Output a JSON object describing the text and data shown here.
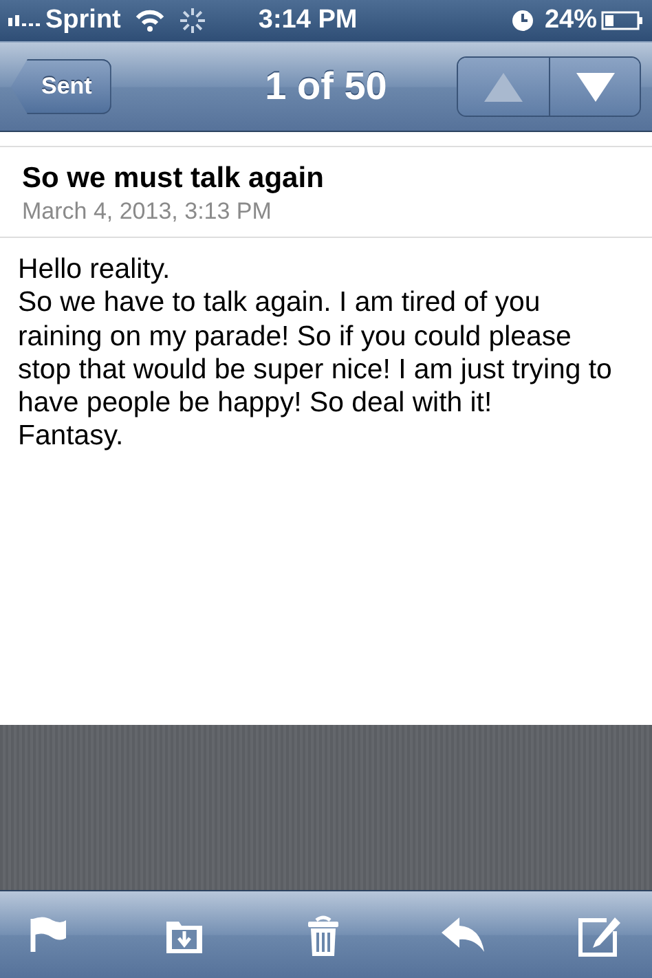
{
  "status_bar": {
    "carrier": "Sprint",
    "time": "3:14 PM",
    "battery": "24%"
  },
  "nav_bar": {
    "back": "Sent",
    "title": "1 of 50",
    "previous": {
      "disabled": true
    },
    "next": {
      "disabled": false
    }
  },
  "message": {
    "subject": "So we must talk again",
    "date": "March 4, 2013, 3:13 PM",
    "body": [
      "Hello reality.",
      "So we have to talk again. I am tired of you raining on my parade! So if you could please stop that would be super nice! I am just trying to have people be happy! So deal with it!",
      "Fantasy."
    ]
  },
  "toolbar": [
    {
      "kind": "flag"
    },
    {
      "kind": "move"
    },
    {
      "kind": "trash"
    },
    {
      "kind": "reply"
    },
    {
      "kind": "compose"
    }
  ]
}
